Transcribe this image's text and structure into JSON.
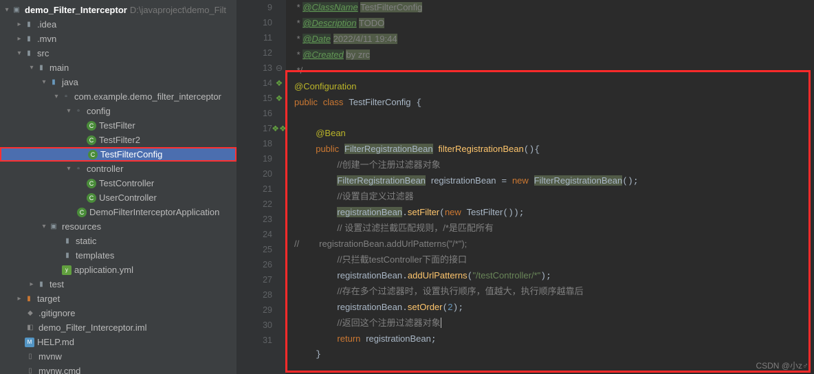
{
  "project": {
    "name": "demo_Filter_Interceptor",
    "path": "D:\\javaproject\\demo_Filt"
  },
  "tree": {
    "idea": ".idea",
    "mvn": ".mvn",
    "src": "src",
    "main": "main",
    "java": "java",
    "pkg": "com.example.demo_filter_interceptor",
    "config": "config",
    "testfilter": "TestFilter",
    "testfilter2": "TestFilter2",
    "testfilterconfig": "TestFilterConfig",
    "controller": "controller",
    "testcontroller": "TestController",
    "usercontroller": "UserController",
    "app": "DemoFilterInterceptorApplication",
    "resources": "resources",
    "static": "static",
    "templates": "templates",
    "yml": "application.yml",
    "test": "test",
    "target": "target",
    "gitignore": ".gitignore",
    "iml": "demo_Filter_Interceptor.iml",
    "help": "HELP.md",
    "mvnw": "mvnw",
    "mvnwcmd": "mvnw.cmd"
  },
  "lineNumbers": [
    "9",
    "10",
    "11",
    "12",
    "13",
    "14",
    "15",
    "16",
    "17",
    "18",
    "19",
    "20",
    "21",
    "22",
    "23",
    "24",
    "25",
    "26",
    "27",
    "28",
    "29",
    "30",
    "31"
  ],
  "code": {
    "classname": "@ClassName",
    "classname_v": "TestFilterConfig",
    "description": "@Description",
    "todo": "TODO",
    "date": "@Date",
    "date_v": "2022/4/11 19:44",
    "created": "@Created",
    "created_v": "by zrc",
    "close": " */",
    "ann_cfg": "@Configuration",
    "public": "public",
    "class": "class",
    "clsname": "TestFilterConfig",
    "bean": "@Bean",
    "type_frb": "FilterRegistrationBean",
    "meth_frb": "filterRegistrationBean",
    "c1": "//创建一个注册过滤器对象",
    "var_rb": "registrationBean",
    "new": "new",
    "c2": "//设置自定义过滤器",
    "set_filter": "setFilter",
    "tf": "TestFilter",
    "c3": "// 设置过滤拦截匹配规则，/*是匹配所有",
    "c4": "//        registrationBean.addUrlPatterns(\"/*\");",
    "c5": "//只拦截testController下面的接口",
    "addurl": "addUrlPatterns",
    "pattern": "\"/testController/*\"",
    "c6": "//存在多个过滤器时，设置执行顺序，值越大，执行顺序越靠后",
    "setorder": "setOrder",
    "order_v": "2",
    "c7": "//返回这个注册过滤器对象",
    "return": "return"
  },
  "watermark": "CSDN @小z♂"
}
